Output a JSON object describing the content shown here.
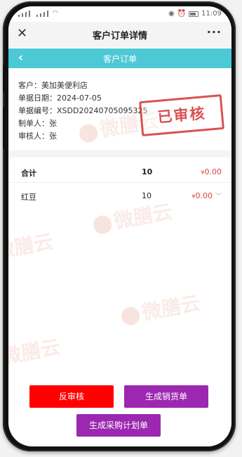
{
  "statusbar": {
    "left_text": "4G",
    "time": "11:09"
  },
  "titlebar": {
    "close_icon": "close-icon",
    "title": "客户订单详情",
    "more_label": "···"
  },
  "header": {
    "back_icon": "chevron-left-icon",
    "title": "客户订单",
    "color": "#4dc9d6"
  },
  "order": {
    "customer_label": "客户：",
    "customer": "美加美便利店",
    "date_label": "单据日期：",
    "date": "2024-07-05",
    "number_label": "单据编号：",
    "number": "XSDD20240705095325",
    "maker_label": "制单人：",
    "maker": "张",
    "reviewer_label": "审核人：",
    "reviewer": "张"
  },
  "stamp": {
    "text": "已审核",
    "color": "#d63a3a"
  },
  "total_row": {
    "label": "合计",
    "qty": "10",
    "currency": "¥",
    "amount": "0.00"
  },
  "items": [
    {
      "name": "红豆",
      "qty": "10",
      "currency": "¥",
      "amount": "0.00"
    }
  ],
  "watermark": "微膳云",
  "buttons": {
    "unreview": "反审核",
    "delivery": "生成销货单",
    "purchase_plan": "生成采购计划单",
    "red": "#ff0000",
    "purple": "#9c27b0"
  }
}
